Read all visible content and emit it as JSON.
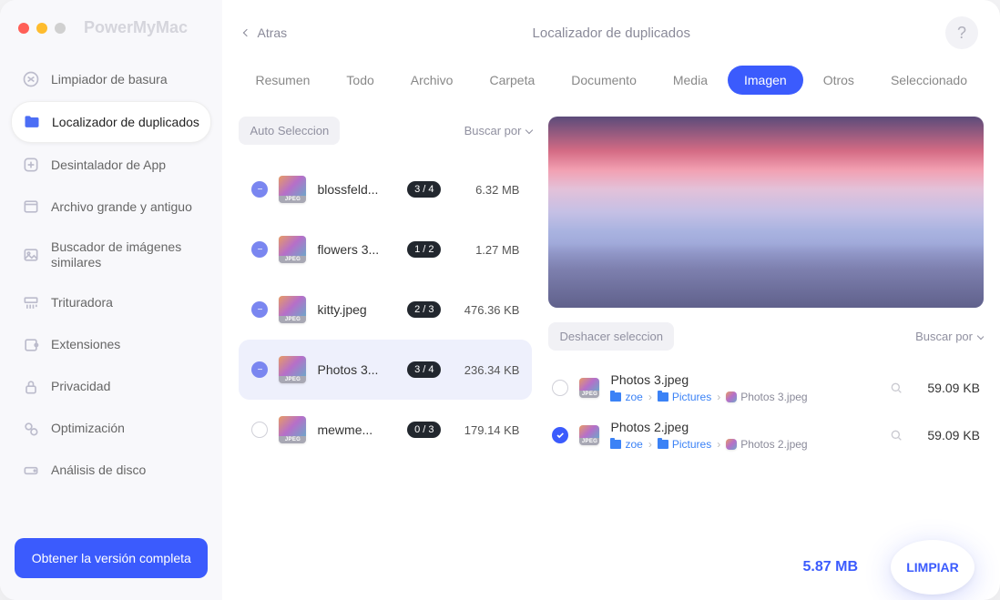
{
  "window": {
    "app_title": "PowerMyMac",
    "back_label": "Atras",
    "title": "Localizador de duplicados",
    "help_label": "?"
  },
  "sidebar": {
    "items": [
      {
        "label": "Limpiador de basura"
      },
      {
        "label": "Localizador de duplicados"
      },
      {
        "label": "Desintalador de App"
      },
      {
        "label": "Archivo grande y antiguo"
      },
      {
        "label": "Buscador de imágenes similares"
      },
      {
        "label": "Trituradora"
      },
      {
        "label": "Extensiones"
      },
      {
        "label": "Privacidad"
      },
      {
        "label": "Optimización"
      },
      {
        "label": "Análisis de disco"
      }
    ],
    "cta": "Obtener la versión completa"
  },
  "tabs": [
    "Resumen",
    "Todo",
    "Archivo",
    "Carpeta",
    "Documento",
    "Media",
    "Imagen",
    "Otros",
    "Seleccionado"
  ],
  "left": {
    "auto_select": "Auto Seleccion",
    "sort_by": "Buscar por",
    "rows": [
      {
        "name": "blossfeld...",
        "badge": "3 / 4",
        "size": "6.32 MB",
        "checked": true
      },
      {
        "name": "flowers 3...",
        "badge": "1 / 2",
        "size": "1.27 MB",
        "checked": true
      },
      {
        "name": "kitty.jpeg",
        "badge": "2 / 3",
        "size": "476.36 KB",
        "checked": true
      },
      {
        "name": "Photos 3...",
        "badge": "3 / 4",
        "size": "236.34 KB",
        "checked": true
      },
      {
        "name": "mewme...",
        "badge": "0 / 3",
        "size": "179.14 KB",
        "checked": false
      }
    ],
    "thumb_format": "JPEG"
  },
  "right": {
    "deselect": "Deshacer seleccion",
    "sort_by": "Buscar por",
    "rows": [
      {
        "name": "Photos 3.jpeg",
        "path": [
          "zoe",
          "Pictures",
          "Photos 3.jpeg"
        ],
        "size": "59.09 KB",
        "checked": false
      },
      {
        "name": "Photos 2.jpeg",
        "path": [
          "zoe",
          "Pictures",
          "Photos 2.jpeg"
        ],
        "size": "59.09 KB",
        "checked": true
      }
    ]
  },
  "footer": {
    "total": "5.87 MB",
    "clean": "LIMPIAR"
  }
}
